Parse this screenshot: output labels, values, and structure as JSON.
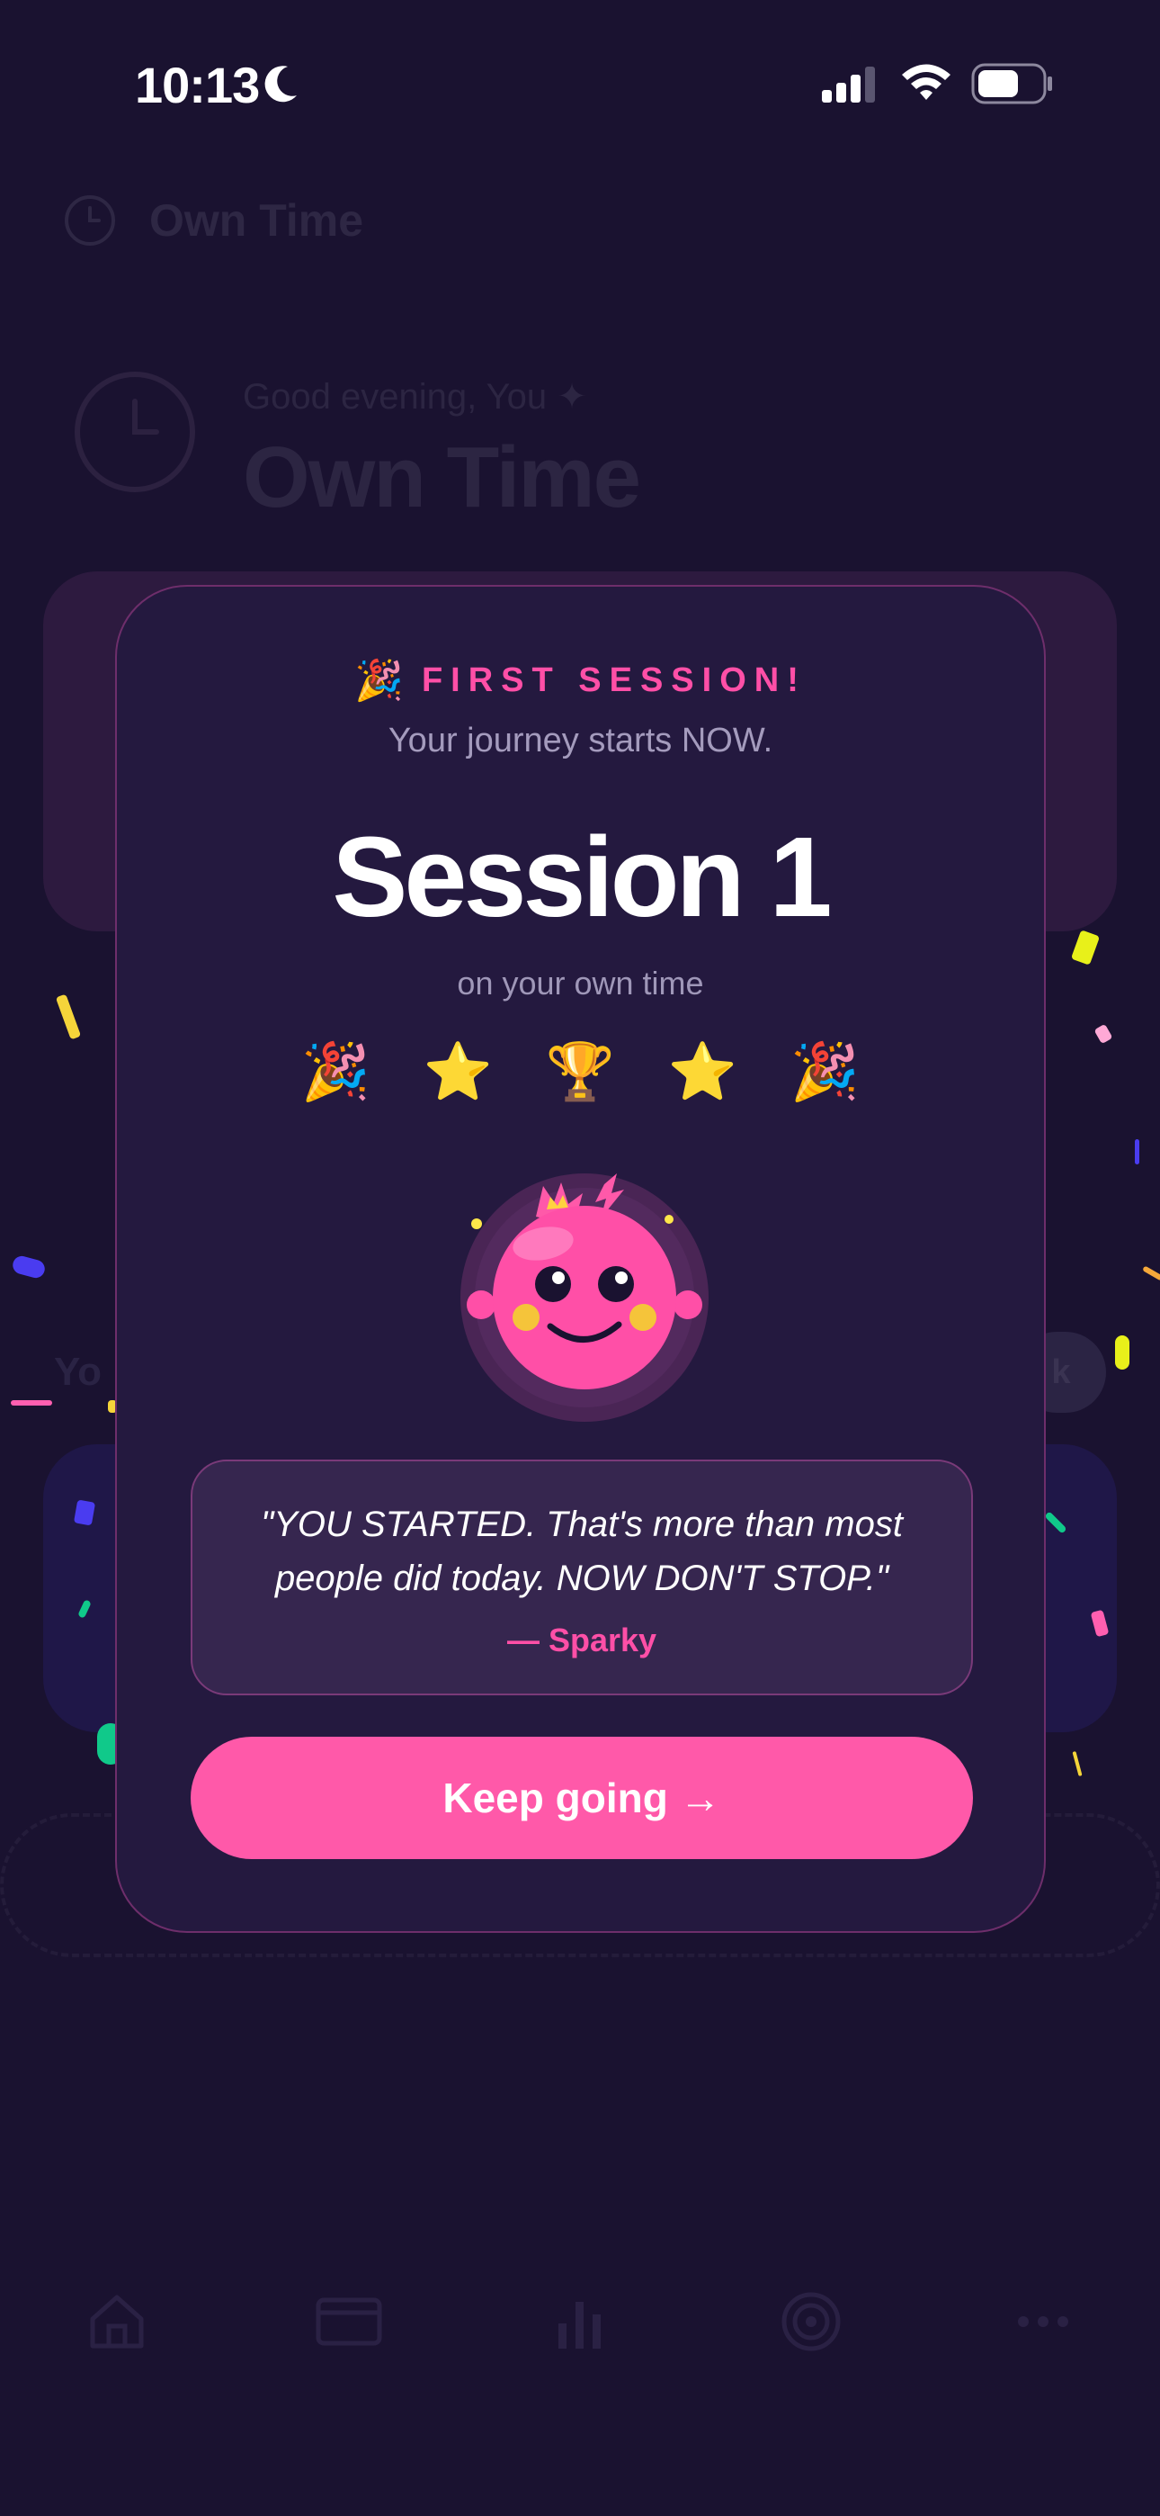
{
  "status_bar": {
    "time": "10:13"
  },
  "background_app": {
    "header_title": "Own Time",
    "greeting": "Good evening, You ✦",
    "big_title": "Own Time",
    "section_label": "Yo",
    "pill_label": "k"
  },
  "modal": {
    "badge_emoji": "🎉",
    "badge_text": "FIRST SESSION!",
    "subtitle": "Your journey starts NOW.",
    "session_title": "Session 1",
    "session_sub": "on your own time",
    "emojis": [
      "🎉",
      "⭐",
      "🏆",
      "⭐",
      "🎉"
    ],
    "quote": "\"YOU STARTED. That's more than most people did today. NOW DON'T STOP.\"",
    "quote_author": "— Sparky",
    "cta_label": "Keep going →"
  },
  "colors": {
    "background": "#1a1230",
    "modal": "#24193f",
    "accent_pink": "#ff59a9",
    "badge_pink": "#ff4fa7"
  },
  "icons": {
    "status": [
      "moon-icon",
      "signal-icon",
      "wifi-icon",
      "battery-icon"
    ],
    "tabs": [
      "home-icon",
      "card-icon",
      "chart-icon",
      "target-icon",
      "more-icon"
    ]
  }
}
